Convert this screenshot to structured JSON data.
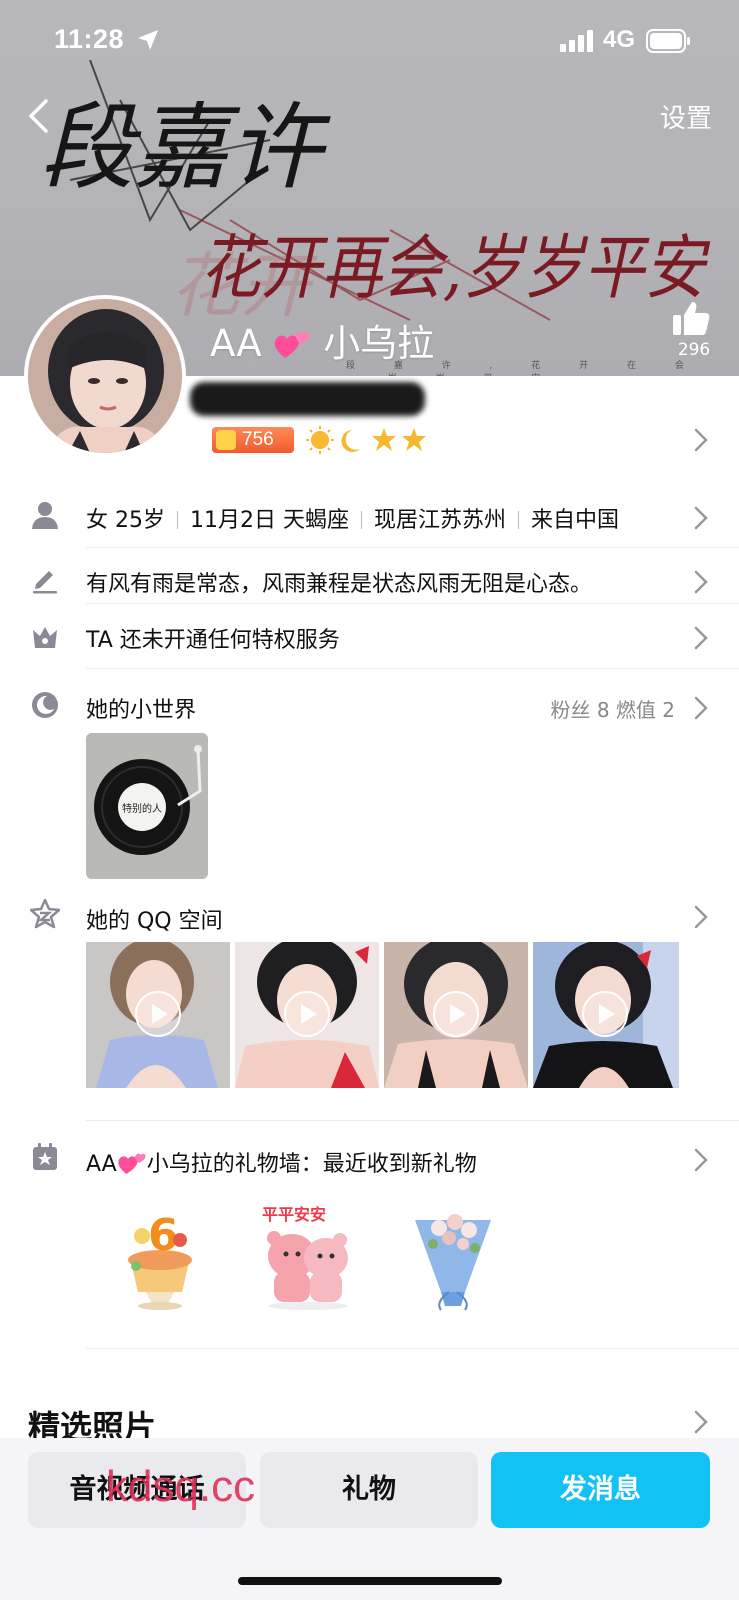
{
  "status_bar": {
    "time": "11:28",
    "network": "4G"
  },
  "header": {
    "settings_label": "设置",
    "banner_text_1": "段嘉许",
    "banner_text_2": "花开再会,岁岁平安",
    "banner_caption": "段 嘉 许 , 花 开 在 会 , 岁 岁 平 安",
    "likes": "296"
  },
  "profile": {
    "nickname_prefix": "AA",
    "nickname_suffix": "小乌拉",
    "level_value": "756"
  },
  "rows": {
    "basic_gender_age": "女 25岁",
    "basic_birthday": "11月2日 天蝎座",
    "basic_location": "现居江苏苏州",
    "basic_origin": "来自中国",
    "signature": "有风有雨是常态，风雨兼程是状态风雨无阻是心态。",
    "privilege": "TA 还未开通任何特权服务",
    "world_title": "她的小世界",
    "world_meta": "粉丝 8  燃值 2",
    "world_card_label": "特别的人",
    "qzone_title": "她的 QQ 空间",
    "gift_wall_prefix": "AA",
    "gift_wall_suffix": "小乌拉的礼物墙：最近收到新礼物",
    "gift_2_label": "平平安安"
  },
  "section": {
    "featured_photos": "精选照片"
  },
  "bottom_bar": {
    "call_label": "音视频通话",
    "gift_label": "礼物",
    "message_label": "发消息",
    "watermark": "kdsq.cc"
  },
  "colors": {
    "accent": "#12c2f5",
    "banner_bg": "#b3b3b7",
    "level_badge": "#f25a2c",
    "calligraphy_red": "#7a1a22"
  },
  "icons": {
    "back": "chevron-left-icon",
    "like": "thumbs-up-icon",
    "person": "person-icon",
    "pencil": "pencil-icon",
    "crown": "crown-icon",
    "world": "moon-circle-icon",
    "qzone": "star-badge-icon",
    "gift": "gift-icon"
  }
}
